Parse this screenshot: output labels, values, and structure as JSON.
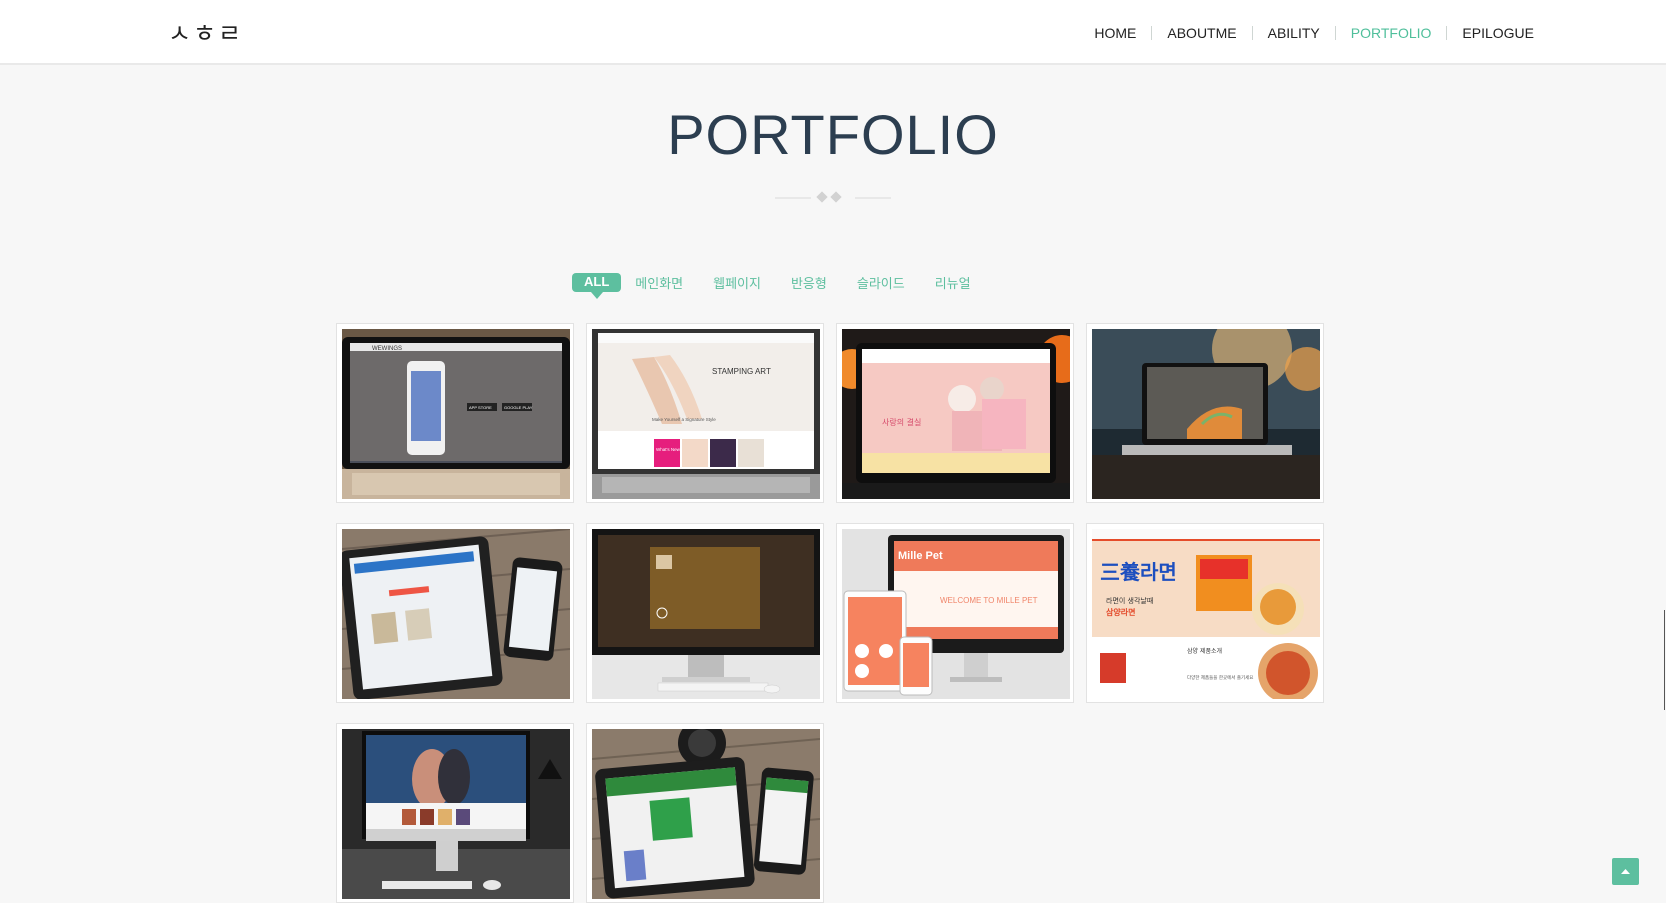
{
  "header": {
    "logo": "ㅅㅎㄹ",
    "nav": [
      {
        "label": "HOME"
      },
      {
        "label": "ABOUTME"
      },
      {
        "label": "ABILITY"
      },
      {
        "label": "PORTFOLIO",
        "active": true
      },
      {
        "label": "EPILOGUE"
      }
    ]
  },
  "section": {
    "title": "PORTFOLIO"
  },
  "filters": [
    "ALL",
    "메인화면",
    "웹페이지",
    "반응형",
    "슬라이드",
    "리뉴얼"
  ],
  "colors": {
    "accent": "#5dbf9f",
    "title": "#2c3e50",
    "background": "#f7f7f7"
  },
  "thumbnails": {
    "t1": [
      "WEWINGS",
      "APP STORE",
      "GOOGLE PLAY"
    ],
    "t2": [
      "STAMPING ART",
      "Make Yourself a Signature Style",
      "What's New"
    ],
    "t3": [
      "사랑의 결실"
    ],
    "t7": [
      "WELCOME TO MILLE PET",
      "Mille Pet"
    ],
    "t8": [
      "三養라면",
      "라면이 생각날때",
      "삼양라면",
      "삼양 제품소개",
      "다양한 제품들을 한곳에서 즐기세요"
    ]
  },
  "icons": {
    "scroll_top": "chevron-up-icon",
    "ornament": "diamond-divider-icon"
  }
}
